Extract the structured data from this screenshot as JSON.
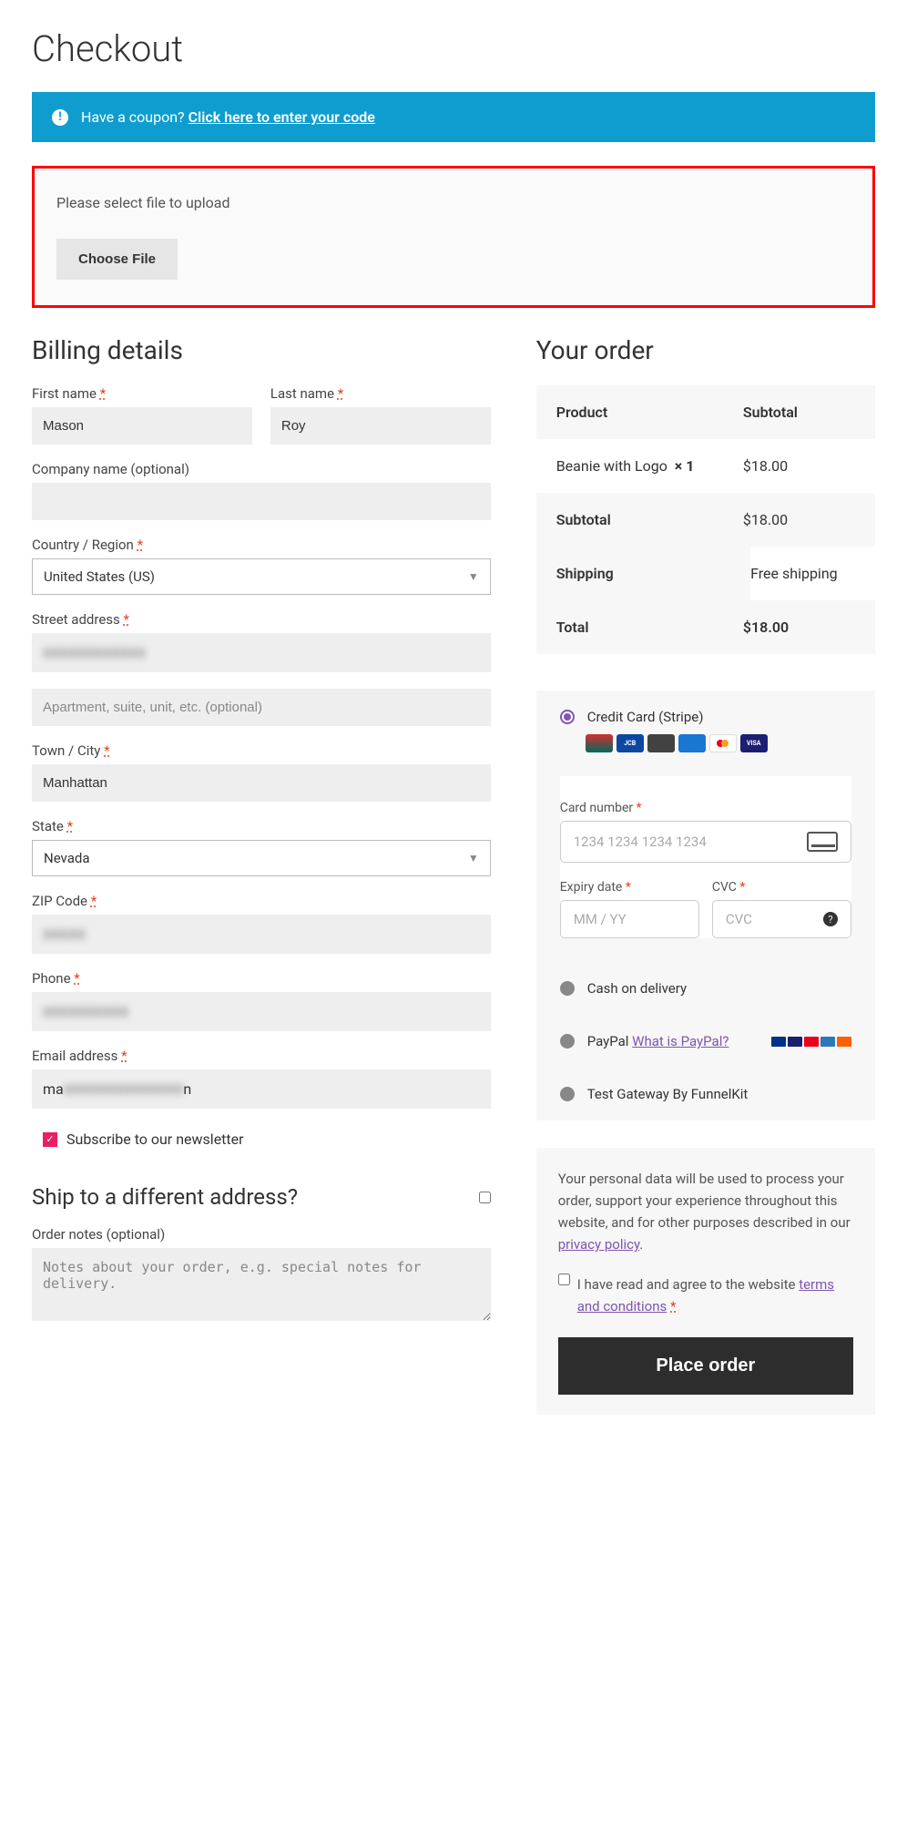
{
  "page_title": "Checkout",
  "coupon": {
    "prompt": "Have a coupon?",
    "link": "Click here to enter your code"
  },
  "upload": {
    "prompt": "Please select file to upload",
    "button": "Choose File"
  },
  "billing": {
    "heading": "Billing details",
    "first_name_label": "First name",
    "first_name_value": "Mason",
    "last_name_label": "Last name",
    "last_name_value": "Roy",
    "company_label": "Company name (optional)",
    "company_value": "",
    "country_label": "Country / Region",
    "country_value": "United States (US)",
    "street_label": "Street address",
    "apt_placeholder": "Apartment, suite, unit, etc. (optional)",
    "city_label": "Town / City",
    "city_value": "Manhattan",
    "state_label": "State",
    "state_value": "Nevada",
    "zip_label": "ZIP Code",
    "phone_label": "Phone",
    "email_label": "Email address",
    "email_prefix": "ma",
    "email_suffix": "n",
    "newsletter_label": "Subscribe to our newsletter",
    "ship_different_heading": "Ship to a different address?",
    "order_notes_label": "Order notes (optional)",
    "order_notes_placeholder": "Notes about your order, e.g. special notes for delivery."
  },
  "order": {
    "heading": "Your order",
    "col_product": "Product",
    "col_subtotal": "Subtotal",
    "item_name": "Beanie with Logo",
    "item_qty": "× 1",
    "item_price": "$18.00",
    "subtotal_label": "Subtotal",
    "subtotal_value": "$18.00",
    "shipping_label": "Shipping",
    "shipping_value": "Free shipping",
    "total_label": "Total",
    "total_value": "$18.00"
  },
  "payment": {
    "stripe_label": "Credit Card (Stripe)",
    "card_number_label": "Card number",
    "card_number_placeholder": "1234 1234 1234 1234",
    "expiry_label": "Expiry date",
    "expiry_placeholder": "MM / YY",
    "cvc_label": "CVC",
    "cvc_placeholder": "CVC",
    "cod_label": "Cash on delivery",
    "paypal_label": "PayPal",
    "paypal_link": "What is PayPal?",
    "test_gateway_label": "Test Gateway By FunnelKit"
  },
  "privacy": {
    "text": "Your personal data will be used to process your order, support your experience throughout this website, and for other purposes described in our ",
    "link": "privacy policy",
    "terms_text": "I have read and agree to the website ",
    "terms_link": "terms and conditions",
    "place_order": "Place order"
  }
}
